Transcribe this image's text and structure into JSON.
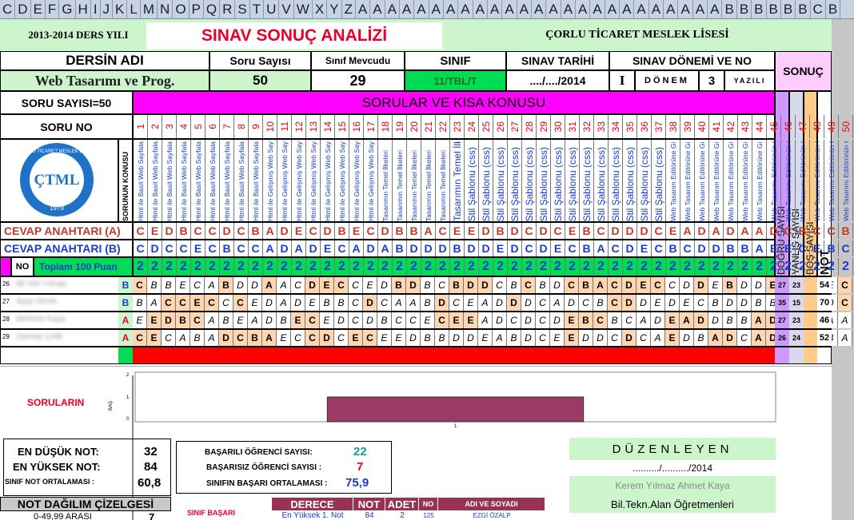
{
  "columns": [
    "C",
    "D",
    "E",
    "F",
    "G",
    "H",
    "I",
    "J",
    "K",
    "L",
    "M",
    "N",
    "O",
    "P",
    "Q",
    "R",
    "S",
    "T",
    "U",
    "V",
    "W",
    "X",
    "Y",
    "Z",
    "A",
    "A",
    "A",
    "A",
    "A",
    "A",
    "A",
    "A",
    "A",
    "A",
    "A",
    "A",
    "A",
    "A",
    "A",
    "A",
    "A",
    "A",
    "A",
    "A",
    "A",
    "A",
    "A",
    "A",
    "A",
    "B",
    "B",
    "B",
    "B",
    "B",
    "B",
    "C",
    "B"
  ],
  "header": {
    "year": "2013-2014 DERS YILI",
    "title": "SINAV SONUÇ ANALİZİ",
    "school": "ÇORLU TİCARET MESLEK LİSESİ"
  },
  "course": {
    "label_course": "DERSİN ADI",
    "course_name": "Web Tasarımı ve Prog.",
    "label_questions": "Soru Sayısı",
    "questions": "50",
    "label_class_size": "Sınıf Mevcudu",
    "class_size": "29",
    "label_class": "SINIF",
    "class_value": "11/TBL/T",
    "label_date": "SINAV TARİHİ",
    "date": "..../..../2014",
    "label_term": "SINAV DÖNEMİ VE NO",
    "term_roman": "I",
    "term_word": "DÖNEM",
    "term_no": "3",
    "term_type": "YAZILI",
    "label_result": "SONUÇ"
  },
  "questions_header": {
    "count_label": "SORU SAYISI=50",
    "banner": "SORULAR VE KISA KONUSU",
    "qno_label": "SORU NO",
    "topic_col_label": "SORUNUN KONUSU",
    "logo_text": "ÇORLU TİCARET MESLEK LİSESİ",
    "logo_year": "1979",
    "logo_mark": "ÇTML",
    "numbers": [
      "1",
      "2",
      "3",
      "4",
      "5",
      "6",
      "7",
      "8",
      "9",
      "10",
      "11",
      "12",
      "13",
      "14",
      "15",
      "16",
      "17",
      "18",
      "19",
      "20",
      "21",
      "22",
      "23",
      "24",
      "25",
      "26",
      "27",
      "28",
      "29",
      "30",
      "31",
      "32",
      "33",
      "34",
      "35",
      "36",
      "37",
      "38",
      "39",
      "40",
      "41",
      "42",
      "43",
      "44",
      "45",
      "46",
      "47",
      "48",
      "49",
      "50"
    ],
    "topics": [
      "Html ile Basit Web Sayfaları",
      "Html ile Basit Web Sayfaları",
      "Html ile Basit Web Sayfaları",
      "Html ile Basit Web Sayfaları",
      "Html ile Basit Web Sayfaları",
      "Html ile Basit Web Sayfaları",
      "Html ile Basit Web Sayfaları",
      "Html ile Basit Web Sayfaları",
      "Html ile Basit Web Sayfaları",
      "Html ile Gelişmiş Web Sayfaları",
      "Html ile Gelişmiş Web Sayfaları",
      "Html ile Gelişmiş Web Sayfaları",
      "Html ile Gelişmiş Web Sayfaları",
      "Html ile Gelişmiş Web Sayfaları",
      "Html ile Gelişmiş Web Sayfaları",
      "Html ile Gelişmiş Web Sayfaları",
      "Html ile Gelişmiş Web Sayfaları",
      "Tasarımın Temel İlkeleri",
      "Tasarımın Temel İlkeleri",
      "Tasarımın Temel İlkeleri",
      "Tasarımın Temel İlkeleri",
      "Tasarımın Temel İlkeleri",
      "Tasarımın Temel İlkeleri",
      "Stil Şablonu (css)",
      "Stil Şablonu (css)",
      "Stil Şablonu (css)",
      "Stil Şablonu (css)",
      "Stil Şablonu (css)",
      "Stil Şablonu (css)",
      "Stil Şablonu (css)",
      "Stil Şablonu (css)",
      "Stil Şablonu (css)",
      "Stil Şablonu (css)",
      "Stil Şablonu (css)",
      "Stil Şablonu (css)",
      "Stil Şablonu (css)",
      "Stil Şablonu (css)",
      "Web Tasarım Editörüne Giriş",
      "Web Tasarım Editörüne Giriş",
      "Web Tasarım Editörüne Giriş",
      "Web Tasarım Editörüne Giriş",
      "Web Tasarım Editörüne Giriş",
      "Web Tasarım Editörüne Giriş",
      "Web Tasarım Editörüne Giriş",
      "Web Tasarımı Editörünün Özelleştirilmesi",
      "Web Tasarımı Editörünün Özelleştirilmesi",
      "Web Tasarımı Editörünün Özelleştirilmesi",
      "Web Tasarımı Editörünün Özelleştirilmesi",
      "Web Tasarımı Editörünün Özelleştirilmesi",
      "Web Tasarımı Editörünün Özelleştirilmesi"
    ]
  },
  "answer_key": {
    "label_a": "CEVAP ANAHTARI (A)",
    "key_a": [
      "C",
      "E",
      "D",
      "B",
      "C",
      "C",
      "D",
      "C",
      "B",
      "A",
      "D",
      "E",
      "C",
      "D",
      "B",
      "E",
      "C",
      "D",
      "B",
      "B",
      "A",
      "C",
      "E",
      "E",
      "D",
      "B",
      "D",
      "C",
      "D",
      "C",
      "E",
      "B",
      "C",
      "D",
      "D",
      "D",
      "C",
      "E",
      "A",
      "D",
      "A",
      "D",
      "A",
      "A",
      "D",
      "C",
      "B",
      "C",
      "C",
      "B"
    ],
    "label_b": "CEVAP ANAHTARI (B)",
    "key_b": [
      "C",
      "D",
      "C",
      "C",
      "E",
      "C",
      "B",
      "C",
      "C",
      "A",
      "D",
      "A",
      "D",
      "E",
      "C",
      "A",
      "D",
      "A",
      "B",
      "D",
      "D",
      "D",
      "B",
      "D",
      "D",
      "E",
      "D",
      "C",
      "D",
      "E",
      "C",
      "B",
      "A",
      "C",
      "D",
      "E",
      "C",
      "B",
      "C",
      "D",
      "D",
      "B",
      "B",
      "A",
      "E",
      "E",
      "C",
      "E",
      "B",
      "C"
    ],
    "no_label": "NO",
    "points_label": "Toplam 100 Puan",
    "points": [
      "2",
      "2",
      "2",
      "2",
      "2",
      "2",
      "2",
      "2",
      "2",
      "2",
      "2",
      "2",
      "2",
      "2",
      "2",
      "2",
      "2",
      "2",
      "2",
      "2",
      "2",
      "2",
      "2",
      "2",
      "2",
      "2",
      "2",
      "2",
      "2",
      "2",
      "2",
      "2",
      "2",
      "2",
      "2",
      "2",
      "2",
      "2",
      "2",
      "2",
      "2",
      "2",
      "2",
      "2",
      "2",
      "2",
      "2",
      "2",
      "2",
      "2"
    ]
  },
  "result_headers": {
    "correct": "DOĞRU SAYISI",
    "wrong": "YANLIŞ SAYISI",
    "blank": "BOŞ SAYISI",
    "grade": "NOT"
  },
  "students": [
    {
      "row": "26",
      "name": "Ali Veli Yılmaz",
      "group": "B",
      "answers": [
        "C",
        "B",
        "B",
        "E",
        "C",
        "A",
        "B",
        "D",
        "D",
        "A",
        "A",
        "C",
        "D",
        "E",
        "C",
        "C",
        "E",
        "D",
        "B",
        "D",
        "B",
        "C",
        "B",
        "D",
        "D",
        "C",
        "B",
        "C",
        "B",
        "D",
        "C",
        "B",
        "A",
        "C",
        "D",
        "E",
        "C",
        "C",
        "D",
        "D",
        "E",
        "B",
        "D",
        "D",
        "E",
        "E",
        "C",
        "C",
        "E",
        "C"
      ],
      "correct": "27",
      "wrong": "23",
      "blank": "",
      "grade": "54"
    },
    {
      "row": "27",
      "name": "Ayşe Demir",
      "group": "B",
      "answers": [
        "B",
        "A",
        "C",
        "C",
        "E",
        "C",
        "C",
        "C",
        "E",
        "D",
        "A",
        "D",
        "E",
        "B",
        "B",
        "C",
        "D",
        "C",
        "A",
        "A",
        "B",
        "D",
        "C",
        "E",
        "A",
        "D",
        "D",
        "D",
        "C",
        "A",
        "D",
        "C",
        "B",
        "C",
        "D",
        "D",
        "E",
        "D",
        "E",
        "C",
        "B",
        "D",
        "D",
        "B",
        "B",
        "C",
        "B",
        "A",
        "D",
        "C"
      ],
      "correct": "35",
      "wrong": "15",
      "blank": "",
      "grade": "70"
    },
    {
      "row": "28",
      "name": "Mehmet Kaya",
      "group": "A",
      "answers": [
        "E",
        "E",
        "D",
        "B",
        "C",
        "A",
        "B",
        "E",
        "A",
        "D",
        "B",
        "E",
        "C",
        "E",
        "D",
        "C",
        "D",
        "B",
        "C",
        "C",
        "E",
        "C",
        "E",
        "E",
        "A",
        "D",
        "C",
        "D",
        "C",
        "D",
        "E",
        "B",
        "C",
        "B",
        "C",
        "A",
        "D",
        "E",
        "A",
        "D",
        "D",
        "B",
        "B",
        "A",
        "D",
        "A",
        "C",
        "B",
        "A",
        "A"
      ],
      "correct": "27",
      "wrong": "23",
      "blank": "",
      "grade": "46"
    },
    {
      "row": "29",
      "name": "Zeynep Çelik",
      "group": "A",
      "answers": [
        "C",
        "E",
        "C",
        "A",
        "B",
        "A",
        "D",
        "C",
        "B",
        "A",
        "E",
        "C",
        "C",
        "D",
        "C",
        "E",
        "C",
        "E",
        "E",
        "D",
        "B",
        "B",
        "D",
        "D",
        "E",
        "A",
        "B",
        "D",
        "C",
        "E",
        "E",
        "D",
        "D",
        "C",
        "D",
        "C",
        "A",
        "E",
        "D",
        "B",
        "A",
        "D",
        "C",
        "A",
        "D",
        "C",
        "B",
        "D",
        "B",
        "A"
      ],
      "correct": "26",
      "wrong": "24",
      "blank": "",
      "grade": "52"
    }
  ],
  "chart": {
    "title": "SORULARIN",
    "y_label": "BAŞ",
    "x_tick": "1",
    "y_ticks": [
      "2",
      "1",
      "0"
    ]
  },
  "chart_data": {
    "type": "bar",
    "categories": [
      "1"
    ],
    "values": [
      1
    ],
    "ylim": [
      0,
      2
    ],
    "title": "SORULARIN",
    "xlabel": "",
    "ylabel": "BAŞ",
    "color": "#9c3a66"
  },
  "stats": {
    "low_label": "EN DÜŞÜK NOT:",
    "low": "32",
    "high_label": "EN YÜKSEK NOT:",
    "high": "84",
    "avg_label": "SINIF NOT ORTALAMASI :",
    "avg": "60,8",
    "pass_label": "BAŞARILI ÖĞRENCİ SAYISI:",
    "pass": "22",
    "fail_label": "BAŞARISIZ ÖĞRENCİ SAYISI :",
    "fail": "7",
    "rate_label": "SINIFIN BAŞARI ORTALAMASI :",
    "rate": "75,9"
  },
  "organizer": {
    "title": "DÜZENLEYEN",
    "date": "........../........../2014",
    "name": "Kerem Yılmaz  Ahmet Kaya",
    "role": "Bil.Tekn.Alan Öğretmenleri"
  },
  "distribution": {
    "title": "NOT DAĞILIM ÇİZELGESİ",
    "first_row": "0-49,99 ARASI",
    "first_count": "7",
    "class_success": "SINIF BAŞARI"
  },
  "ranking": {
    "headers": [
      "DERECE",
      "NOT",
      "ADET",
      "NO",
      "ADI VE SOYADI"
    ],
    "row1": [
      "En Yüksek 1. Not",
      "84",
      "2",
      "125",
      "EZGİ ÖZALP"
    ]
  },
  "colors": {
    "banner_magenta": "#ff00ff",
    "title_red": "#e8002a",
    "green": "#00dd55",
    "student_pink": "#ffd6b0",
    "orange": "#ffcc88",
    "blank_red": "#ff0000",
    "purple": "#cc99ff"
  }
}
